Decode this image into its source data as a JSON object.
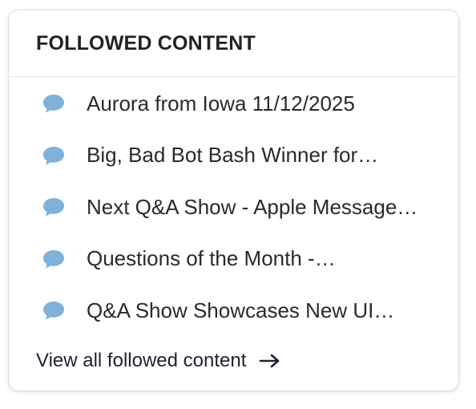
{
  "card": {
    "title": "FOLLOWED CONTENT",
    "items": [
      {
        "icon": "speech-bubble-icon",
        "label": "Aurora from Iowa 11/12/2025"
      },
      {
        "icon": "speech-bubble-icon",
        "label": "Big, Bad Bot Bash Winner for…"
      },
      {
        "icon": "speech-bubble-icon",
        "label": "Next Q&A Show - Apple Message…"
      },
      {
        "icon": "speech-bubble-icon",
        "label": "Questions of the Month -…"
      },
      {
        "icon": "speech-bubble-icon",
        "label": "Q&A Show Showcases New UI…"
      }
    ],
    "footer_link": {
      "label": "View all followed content",
      "icon": "arrow-right-icon"
    }
  },
  "colors": {
    "icon": "#7fb1d9",
    "text": "#2a2a2a",
    "link": "#1d2333"
  }
}
